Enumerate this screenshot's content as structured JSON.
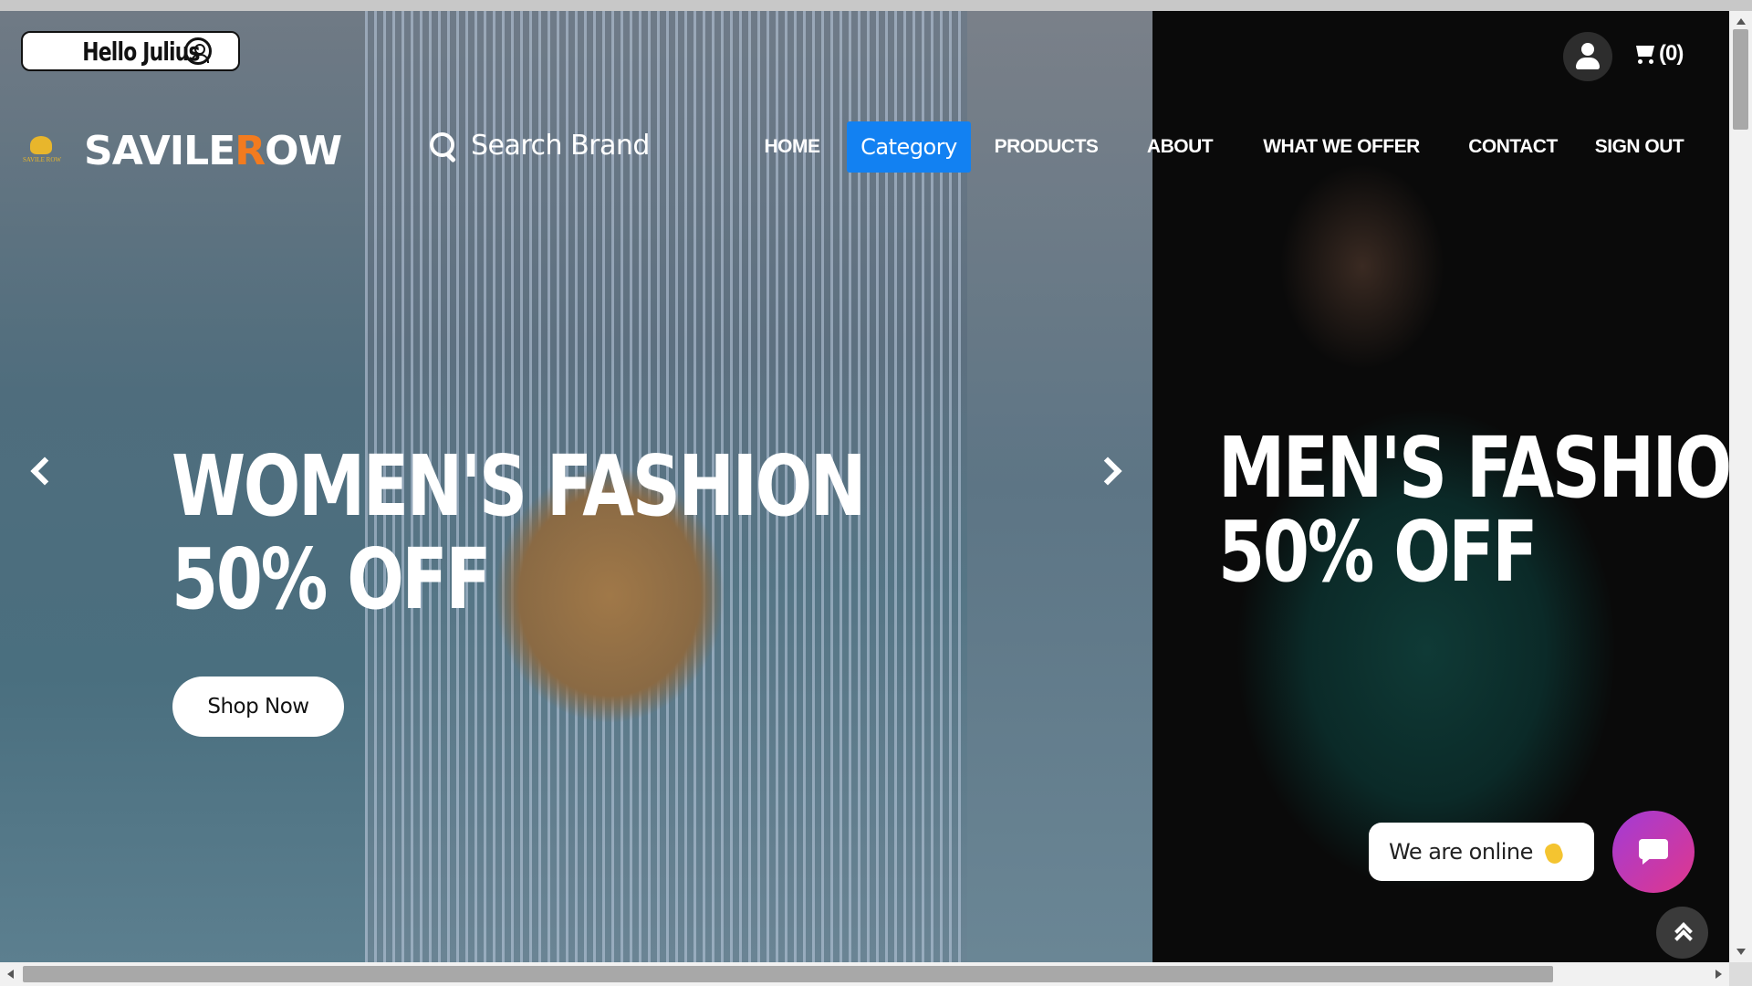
{
  "header": {
    "greeting": "Hello Julius",
    "cart_count": "(0)",
    "logo": {
      "emblem_text": "SAVILE ROW",
      "word_part1": "SAVILE",
      "word_accent": "R",
      "word_part2": "OW",
      "accent_color": "#f27b1f"
    },
    "search_placeholder": "Search Brand",
    "nav": [
      {
        "label": "HOME",
        "active": false
      },
      {
        "label": "Category",
        "active": true
      },
      {
        "label": "PRODUCTS",
        "active": false
      },
      {
        "label": "ABOUT",
        "active": false
      },
      {
        "label": "WHAT WE OFFER",
        "active": false
      },
      {
        "label": "CONTACT",
        "active": false
      },
      {
        "label": "SIGN OUT",
        "active": false
      }
    ],
    "active_color": "#1281f2"
  },
  "hero": {
    "slides": [
      {
        "line1": "WOMEN'S FASHION",
        "line2": "50% OFF",
        "cta": "Shop Now"
      },
      {
        "line1": "MEN'S FASHION",
        "line2": "50% OFF"
      }
    ]
  },
  "chat": {
    "message": "We are online"
  },
  "icons": {
    "account": "user-circle-icon",
    "user": "user-icon",
    "cart": "cart-icon",
    "search": "search-icon",
    "prev": "chevron-left-icon",
    "next": "chevron-right-icon",
    "chat": "chat-icon",
    "wave": "waving-hand-icon",
    "to_top": "double-chevron-up-icon"
  }
}
